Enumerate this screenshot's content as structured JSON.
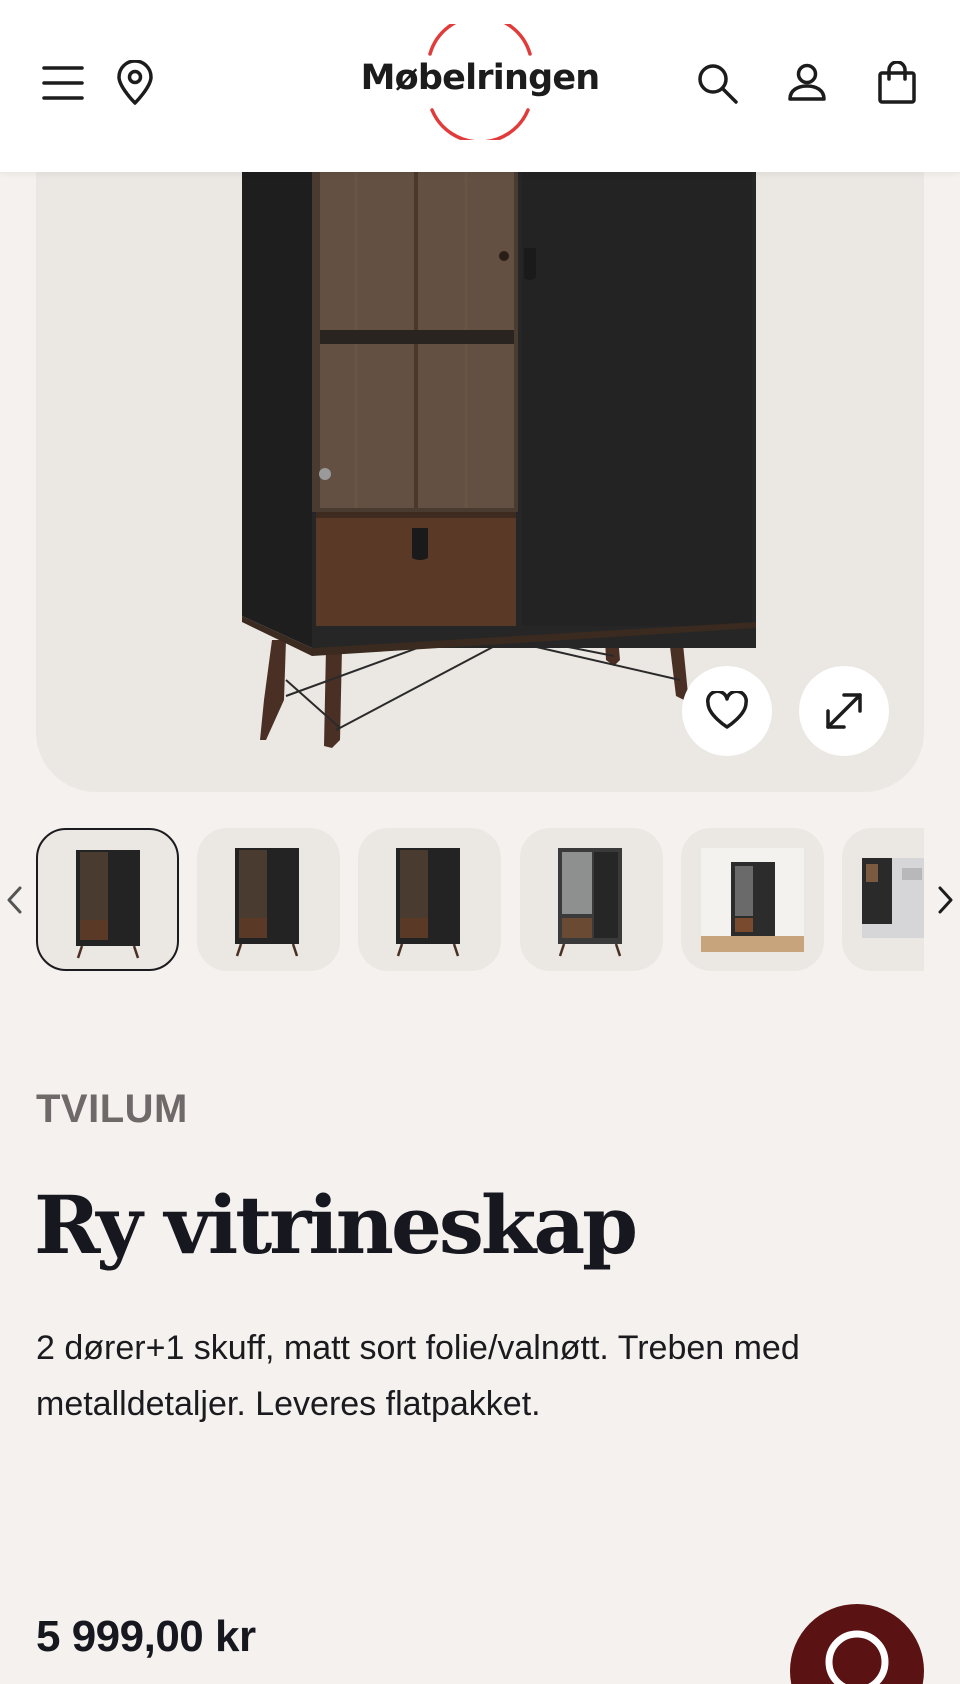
{
  "header": {
    "logo_text": "Møbelringen",
    "brand_color": "#e13b3b",
    "icons": [
      "menu-icon",
      "location-pin-icon",
      "search-icon",
      "user-icon",
      "shopping-bag-icon"
    ]
  },
  "gallery": {
    "favorite_icon": "heart-icon",
    "fullscreen_icon": "expand-icon",
    "thumbnail_count": 6,
    "active_thumbnail": 1
  },
  "product": {
    "brand": "TVILUM",
    "title": "Ry vitrineskap",
    "description": "2 dører+1 skuff, matt sort folie/valnøtt. Treben med metalldetaljer. Leveres flatpakket.",
    "price": "5 999,00 kr"
  },
  "chat": {
    "icon": "chat-icon",
    "color": "#5a1212"
  }
}
